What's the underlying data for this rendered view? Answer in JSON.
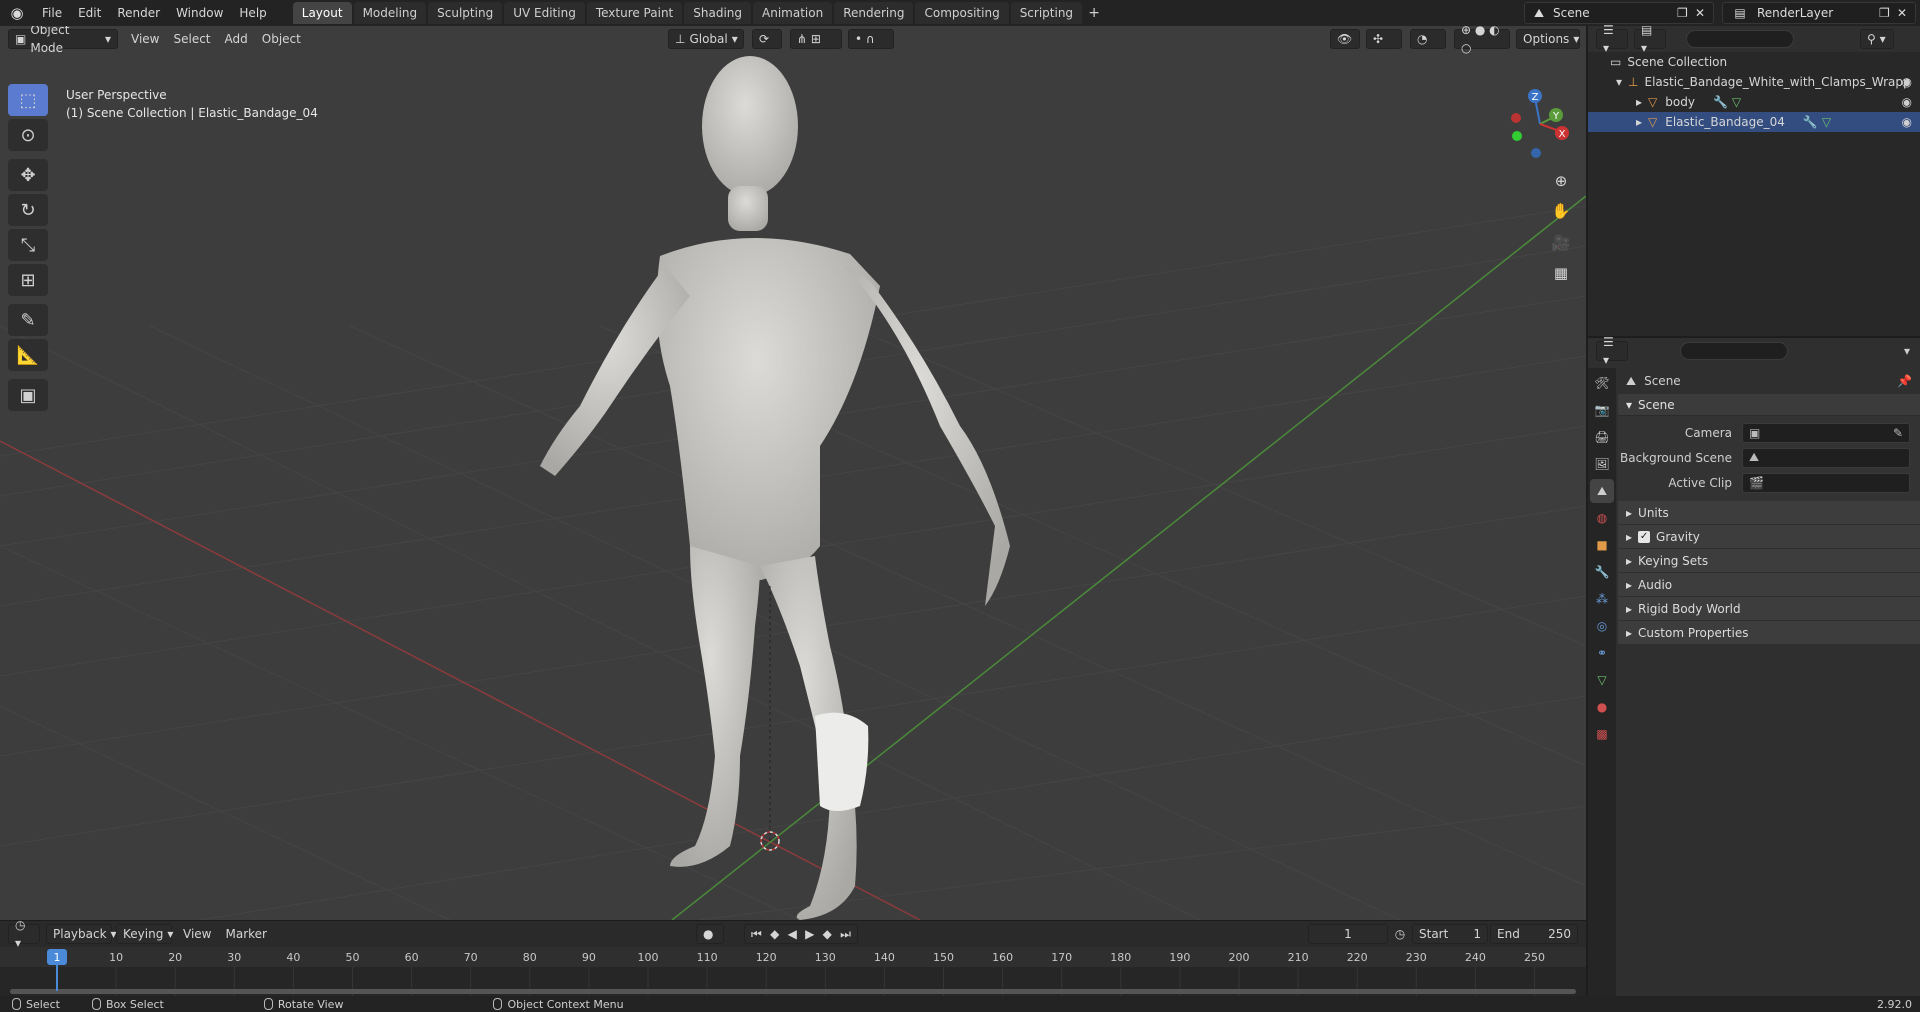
{
  "topbar": {
    "menus": [
      "File",
      "Edit",
      "Render",
      "Window",
      "Help"
    ],
    "workspaces": [
      "Layout",
      "Modeling",
      "Sculpting",
      "UV Editing",
      "Texture Paint",
      "Shading",
      "Animation",
      "Rendering",
      "Compositing",
      "Scripting"
    ],
    "active_workspace": "Layout",
    "add_tab": "+",
    "scene_name": "Scene",
    "view_layer": "RenderLayer"
  },
  "viewport": {
    "mode": "Object Mode",
    "menus": [
      "View",
      "Select",
      "Add",
      "Object"
    ],
    "transform_orientation": "Global",
    "options_label": "Options",
    "info_line1": "User Perspective",
    "info_line2": "(1) Scene Collection | Elastic_Bandage_04",
    "gizmo_labels": {
      "z": "Z",
      "y": "Y",
      "x": "X"
    }
  },
  "outliner": {
    "root": "Scene Collection",
    "items": [
      {
        "label": "Elastic_Bandage_White_with_Clamps_Wrapp",
        "level": 1
      },
      {
        "label": "body",
        "level": 2
      },
      {
        "label": "Elastic_Bandage_04",
        "level": 2
      }
    ]
  },
  "properties": {
    "context_title": "Scene",
    "panel_title": "Scene",
    "rows": [
      {
        "label": "Camera"
      },
      {
        "label": "Background Scene"
      },
      {
        "label": "Active Clip"
      }
    ],
    "subpanels": [
      "Units",
      "Gravity",
      "Keying Sets",
      "Audio",
      "Rigid Body World",
      "Custom Properties"
    ]
  },
  "timeline": {
    "menus": [
      "Playback",
      "Keying",
      "View",
      "Marker"
    ],
    "current_frame": "1",
    "start_label": "Start",
    "start_value": "1",
    "end_label": "End",
    "end_value": "250",
    "ruler_labels": [
      "10",
      "20",
      "30",
      "40",
      "50",
      "60",
      "70",
      "80",
      "90",
      "100",
      "110",
      "120",
      "130",
      "140",
      "150",
      "160",
      "170",
      "180",
      "190",
      "200",
      "210",
      "220",
      "230",
      "240",
      "250"
    ],
    "playhead_label": "1"
  },
  "statusbar": {
    "select": "Select",
    "box_select": "Box Select",
    "rotate_view": "Rotate View",
    "context_menu": "Object Context Menu",
    "version": "2.92.0"
  }
}
